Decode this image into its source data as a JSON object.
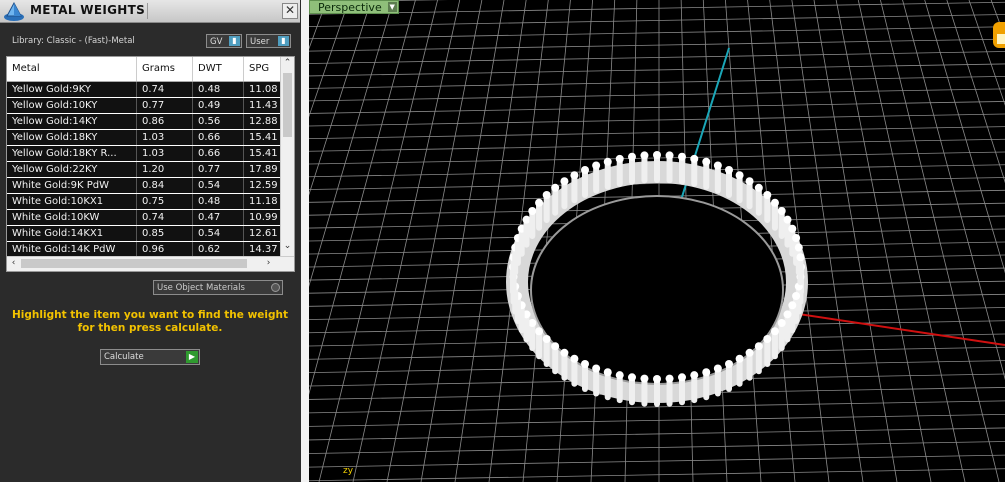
{
  "panel": {
    "title": "METAL WEIGHTS",
    "close_glyph": "✕",
    "library_label": "Library: Classic - (Fast)-Metal",
    "dropdown_gv": "GV",
    "dropdown_user": "User",
    "use_object_materials": "Use Object Materials",
    "hint_line1": "Highlight the item you want to find the weight",
    "hint_line2": "for then press calculate.",
    "calculate_label": "Calculate"
  },
  "table": {
    "columns": [
      "Metal",
      "Grams",
      "DWT",
      "SPG"
    ],
    "rows": [
      [
        "Yellow Gold:9KY",
        "0.74",
        "0.48",
        "11.08"
      ],
      [
        "Yellow Gold:10KY",
        "0.77",
        "0.49",
        "11.43"
      ],
      [
        "Yellow Gold:14KY",
        "0.86",
        "0.56",
        "12.88"
      ],
      [
        "Yellow Gold:18KY",
        "1.03",
        "0.66",
        "15.41"
      ],
      [
        "Yellow Gold:18KY R...",
        "1.03",
        "0.66",
        "15.41"
      ],
      [
        "Yellow Gold:22KY",
        "1.20",
        "0.77",
        "17.89"
      ],
      [
        "White Gold:9K PdW",
        "0.84",
        "0.54",
        "12.59"
      ],
      [
        "White Gold:10KX1",
        "0.75",
        "0.48",
        "11.18"
      ],
      [
        "White Gold:10KW",
        "0.74",
        "0.47",
        "10.99"
      ],
      [
        "White Gold:14KX1",
        "0.85",
        "0.54",
        "12.61"
      ],
      [
        "White Gold:14K PdW",
        "0.96",
        "0.62",
        "14.37"
      ]
    ]
  },
  "viewport": {
    "label": "Perspective",
    "axis_indicator": "zy"
  },
  "colors": {
    "panel_bg": "#2b2b2b",
    "hint_text": "#f2c200",
    "x_axis": "#d01010",
    "y_axis": "#1aa6b7",
    "grid": "#8a8a8a",
    "viewport_tab": "#8fbf7a",
    "calculate_go": "#2f9a2f"
  },
  "icons": {
    "logo": "pyramid-logo-icon",
    "close": "close-icon",
    "dropdown_arrow": "dropdown-arrow-icon",
    "go": "play-arrow-icon"
  }
}
